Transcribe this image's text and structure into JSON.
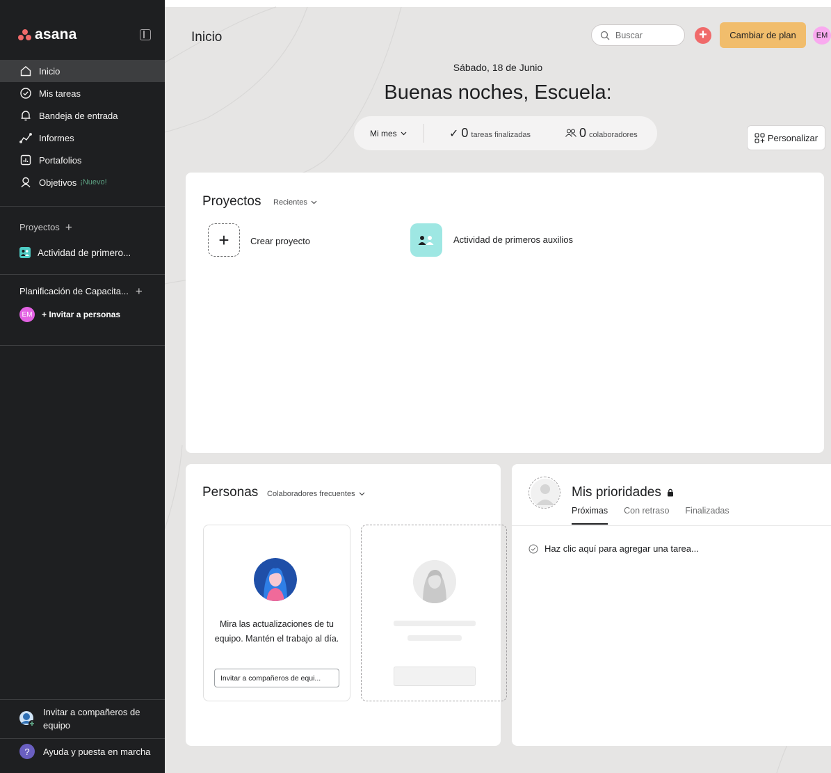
{
  "sidebar": {
    "logo": "asana",
    "nav": [
      {
        "label": "Inicio",
        "icon": "home-icon"
      },
      {
        "label": "Mis tareas",
        "icon": "check-circle-icon"
      },
      {
        "label": "Bandeja de entrada",
        "icon": "bell-icon"
      },
      {
        "label": "Informes",
        "icon": "chart-line-icon"
      },
      {
        "label": "Portafolios",
        "icon": "portfolio-icon"
      },
      {
        "label": "Objetivos",
        "icon": "person-target-icon",
        "badge": "¡Nuevo!"
      }
    ],
    "projects_header": "Proyectos",
    "project_item": "Actividad de primero...",
    "team_header": "Planificación de Capacita...",
    "team_avatar": "EM",
    "invite_people": "+ Invitar a personas",
    "invite_teammates": "Invitar a compañeros de equipo",
    "help": "Ayuda y puesta en marcha",
    "help_icon": "?"
  },
  "header": {
    "title": "Inicio",
    "search_placeholder": "Buscar",
    "add_symbol": "+",
    "upgrade": "Cambiar de plan",
    "avatar": "EM"
  },
  "home": {
    "date": "Sábado, 18 de Junio",
    "greeting": "Buenas noches, Escuela:",
    "period": "Mi mes",
    "tasks_count": "0",
    "tasks_label": "tareas finalizadas",
    "collab_count": "0",
    "collab_label": "colaboradores",
    "customize": "Personalizar"
  },
  "projects": {
    "title": "Proyectos",
    "filter": "Recientes",
    "create": "Crear proyecto",
    "items": [
      {
        "name": "Actividad de primeros auxilios"
      }
    ]
  },
  "people": {
    "title": "Personas",
    "filter": "Colaboradores frecuentes",
    "message": "Mira las actualizaciones de tu equipo. Mantén el trabajo al día.",
    "invite_button": "Invitar a compañeros de equi..."
  },
  "priorities": {
    "title": "Mis prioridades",
    "tabs": [
      "Próximas",
      "Con retraso",
      "Finalizadas"
    ],
    "add_task": "Haz clic aquí para agregar una tarea..."
  },
  "colors": {
    "sidebar_bg": "#1e1f21",
    "accent_coral": "#f06a6a",
    "upgrade_bg": "#f1bd6c",
    "project_teal": "#4ecbc4",
    "new_badge": "#5da283"
  }
}
